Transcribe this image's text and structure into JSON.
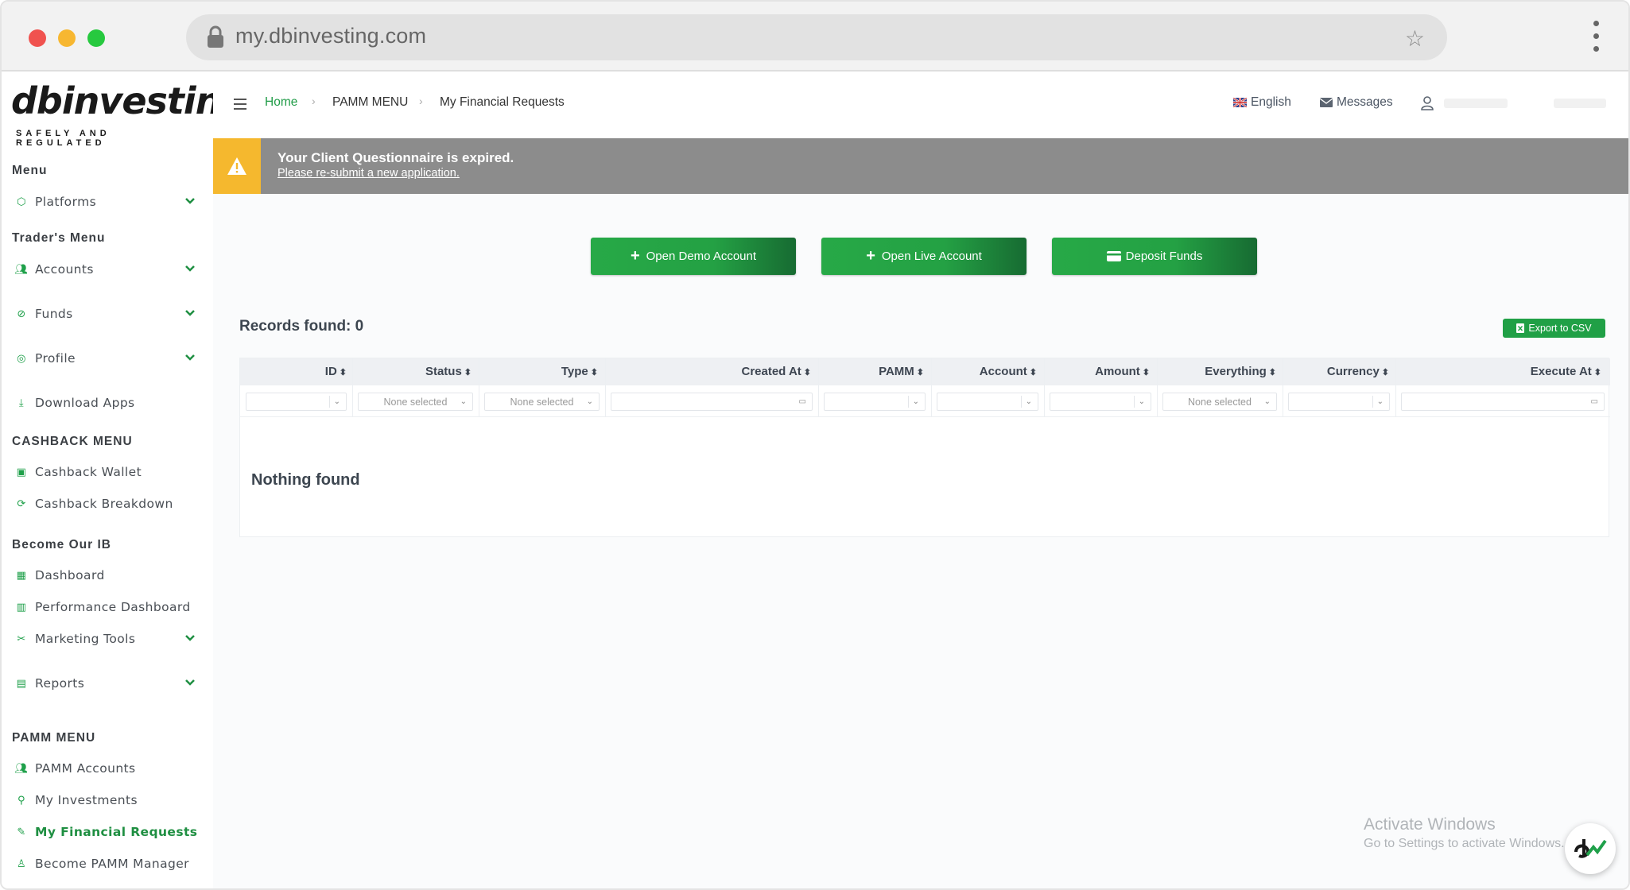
{
  "browser": {
    "url": "my.dbinvesting.com"
  },
  "logo": {
    "text": "dbinvesting",
    "tagline": "SAFELY AND REGULATED"
  },
  "sidebar": {
    "menu_heading": "Menu",
    "platforms": "Platforms",
    "traders_heading": "Trader's Menu",
    "accounts": "Accounts",
    "funds": "Funds",
    "profile": "Profile",
    "download_apps": "Download Apps",
    "cashback_heading": "CASHBACK MENU",
    "cashback_wallet": "Cashback Wallet",
    "cashback_breakdown": "Cashback Breakdown",
    "ib_heading": "Become Our IB",
    "dashboard": "Dashboard",
    "performance_dashboard": "Performance Dashboard",
    "marketing_tools": "Marketing Tools",
    "reports": "Reports",
    "pamm_heading": "PAMM MENU",
    "pamm_accounts": "PAMM Accounts",
    "my_investments": "My Investments",
    "my_financial_requests": "My Financial Requests",
    "become_pamm_manager": "Become PAMM Manager"
  },
  "breadcrumb": {
    "home": "Home",
    "section": "PAMM MENU",
    "current": "My Financial Requests"
  },
  "topbar": {
    "language": "English",
    "messages": "Messages"
  },
  "alert": {
    "title": "Your Client Questionnaire is expired.",
    "link": "Please re-submit a new application."
  },
  "actions": {
    "demo": "Open Demo Account",
    "live": "Open Live Account",
    "deposit": "Deposit Funds"
  },
  "records": {
    "label": "Records found: 0",
    "export": "Export to CSV"
  },
  "table": {
    "columns": [
      "ID",
      "Status",
      "Type",
      "Created At",
      "PAMM",
      "Account",
      "Amount",
      "Everything",
      "Currency",
      "Execute At"
    ],
    "filter_placeholder": "None selected",
    "empty": "Nothing found"
  },
  "watermark": {
    "line1": "Activate Windows",
    "line2": "Go to Settings to activate Windows."
  },
  "colors": {
    "accent": "#1fa04a",
    "alert_bg": "#8c8c8c",
    "alert_icon_bg": "#f5b82e"
  }
}
